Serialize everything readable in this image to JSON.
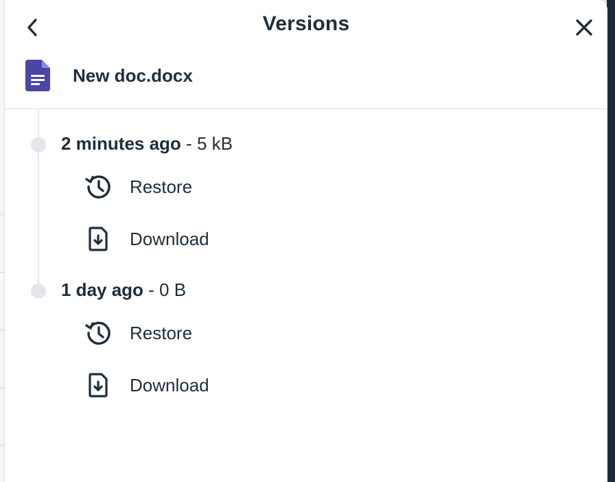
{
  "header": {
    "title": "Versions",
    "file_name": "New doc.docx"
  },
  "versions": [
    {
      "when": "2 minutes ago",
      "separator": " - ",
      "size": "5 kB",
      "actions": [
        {
          "label": "Restore",
          "icon": "history-icon"
        },
        {
          "label": "Download",
          "icon": "download-file-icon"
        }
      ]
    },
    {
      "when": "1 day ago",
      "separator": " - ",
      "size": "0 B",
      "actions": [
        {
          "label": "Restore",
          "icon": "history-icon"
        },
        {
          "label": "Download",
          "icon": "download-file-icon"
        }
      ]
    }
  ],
  "colors": {
    "text": "#1f2d3a",
    "doc_icon": "#4a46a6",
    "timeline": "#e3e6ea",
    "divider": "#dde1e5"
  }
}
